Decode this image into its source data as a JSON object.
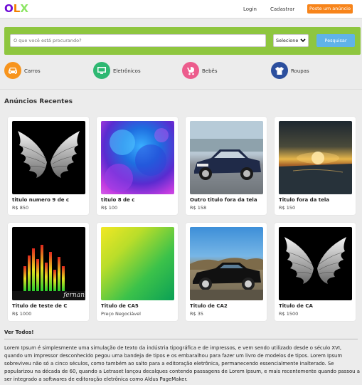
{
  "header": {
    "logo": [
      "O",
      "L",
      "X"
    ],
    "logo_colors": [
      "#6e0ad6",
      "#f28000",
      "#8ce563"
    ],
    "login_label": "Login",
    "register_label": "Cadastrar",
    "post_ad_label": "Poste um anúncio"
  },
  "search": {
    "placeholder": "O que você está procurando?",
    "select_value": "Selecione",
    "button_label": "Pesquisar",
    "bar_color": "#8ec63f"
  },
  "categories": [
    {
      "label": "Carros",
      "icon": "car-icon",
      "color": "#f7941d"
    },
    {
      "label": "Eletrônicos",
      "icon": "monitor-icon",
      "color": "#2eb872"
    },
    {
      "label": "Bebês",
      "icon": "stroller-icon",
      "color": "#ec5d8d"
    },
    {
      "label": "Roupas",
      "icon": "shirt-icon",
      "color": "#2c4f9e"
    }
  ],
  "recent": {
    "title": "Anúncios Recentes",
    "see_all": "Ver Todos!",
    "cards": [
      {
        "title": "titulo numero 9 de c",
        "price": "R$ 850",
        "image": "wings"
      },
      {
        "title": "titulo 8 de c",
        "price": "R$ 100",
        "image": "blue-powder"
      },
      {
        "title": "Outro titulo fora da tela",
        "price": "R$ 158",
        "image": "car-sedan"
      },
      {
        "title": "Titulo fora da tela",
        "price": "R$ 150",
        "image": "sunset"
      },
      {
        "title": "Titulo de teste de C",
        "price": "R$ 1000",
        "image": "equalizer",
        "watermark": "fernan"
      },
      {
        "title": "Titulo de CA5",
        "price": "Preço Negociável",
        "image": "green-gradient"
      },
      {
        "title": "Titulo de CA2",
        "price": "R$ 35",
        "image": "muscle-car"
      },
      {
        "title": "Titulo de CA",
        "price": "R$ 1500",
        "image": "wings"
      }
    ]
  },
  "description": "Lorem Ipsum é simplesmente uma simulação de texto da indústria tipográfica e de impressos, e vem sendo utilizado desde o século XVI, quando um impressor desconhecido pegou uma bandeja de tipos e os embaralhou para fazer um livro de modelos de tipos. Lorem Ipsum sobreviveu não só a cinco séculos, como também ao salto para a editoração eletrônica, permanecendo essencialmente inalterado. Se popularizou na década de 60, quando a Letraset lançou decalques contendo passagens de Lorem Ipsum, e mais recentemente quando passou a ser integrado a softwares de editoração eletrônica como Aldus PageMaker."
}
